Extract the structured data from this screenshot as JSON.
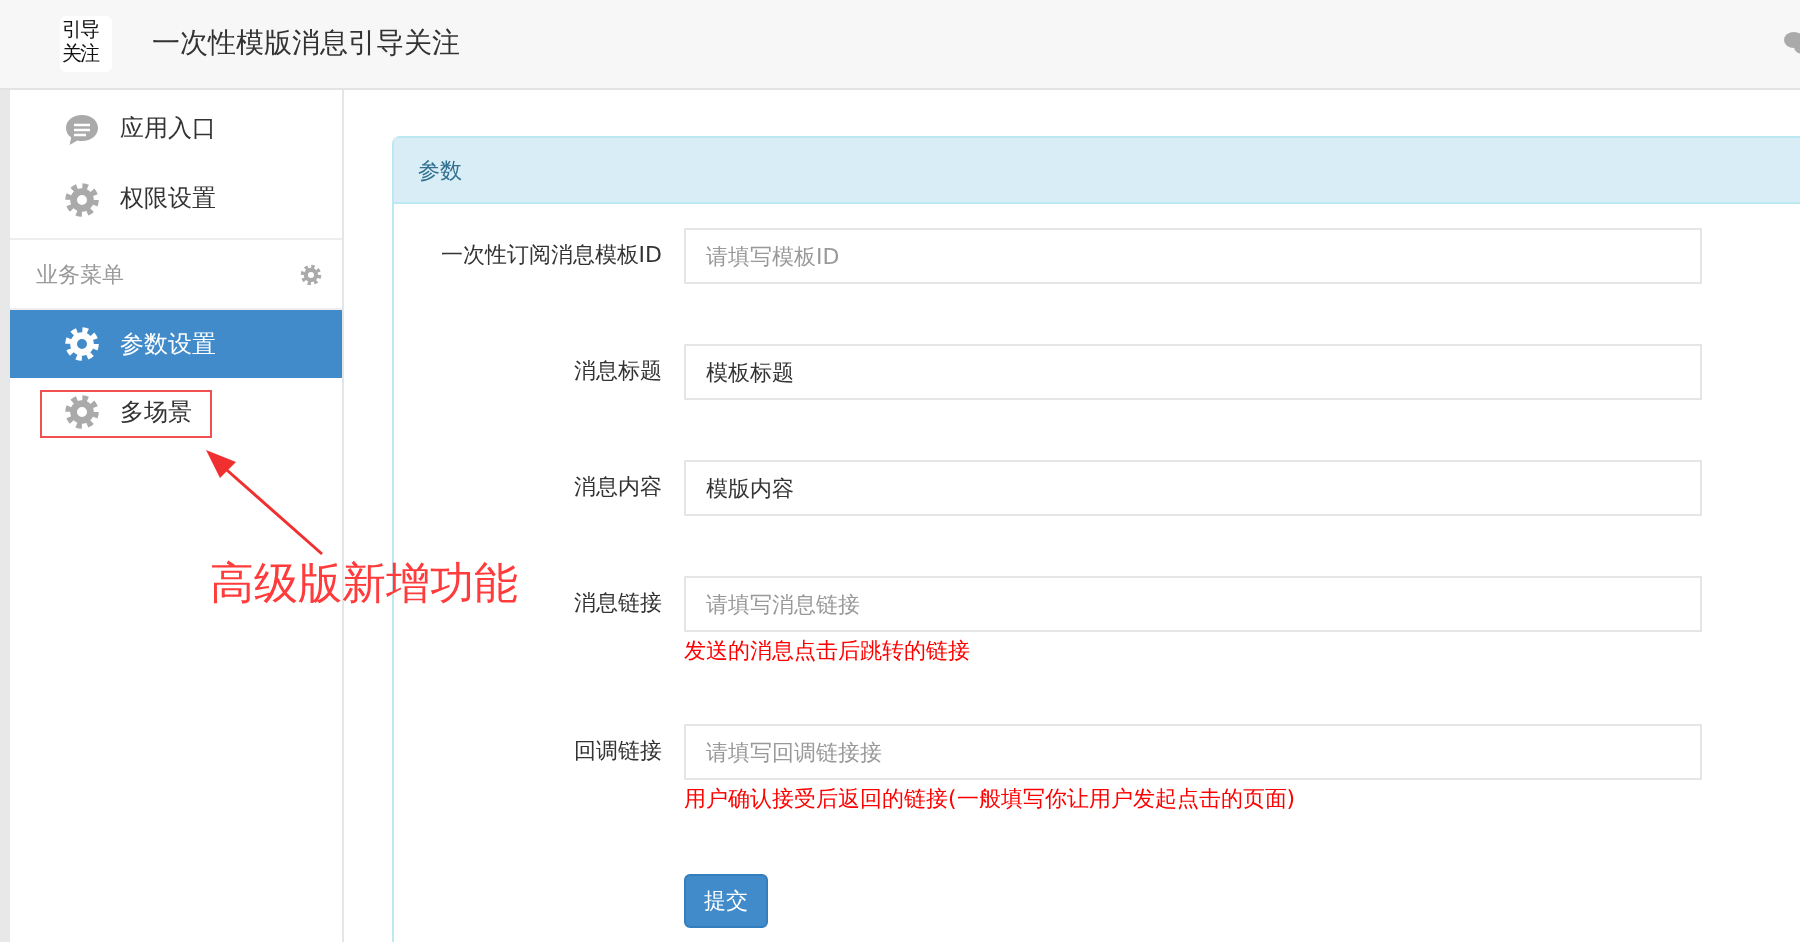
{
  "header": {
    "logo_text": "引导关注",
    "title": "一次性模版消息引导关注"
  },
  "sidebar": {
    "items": [
      {
        "label": "应用入口",
        "kind": "chat",
        "selected": false
      },
      {
        "label": "权限设置",
        "kind": "gear",
        "selected": false
      }
    ],
    "section": {
      "title": "业务菜单",
      "items": [
        {
          "label": "参数设置",
          "selected": true
        },
        {
          "label": "多场景",
          "selected": false
        }
      ]
    }
  },
  "panel": {
    "title": "参数",
    "fields": [
      {
        "label": "一次性订阅消息模板ID",
        "placeholder": "请填写模板ID"
      },
      {
        "label": "消息标题",
        "value": "模板标题"
      },
      {
        "label": "消息内容",
        "value": "模版内容"
      },
      {
        "label": "消息链接",
        "placeholder": "请填写消息链接",
        "help": "发送的消息点击后跳转的链接"
      },
      {
        "label": "回调链接",
        "placeholder": "请填写回调链接接",
        "help": "用户确认接受后返回的链接(一般填写你让用户发起点击的页面)"
      }
    ],
    "submit": "提交"
  },
  "annotation": {
    "text": "高级版新增功能"
  }
}
